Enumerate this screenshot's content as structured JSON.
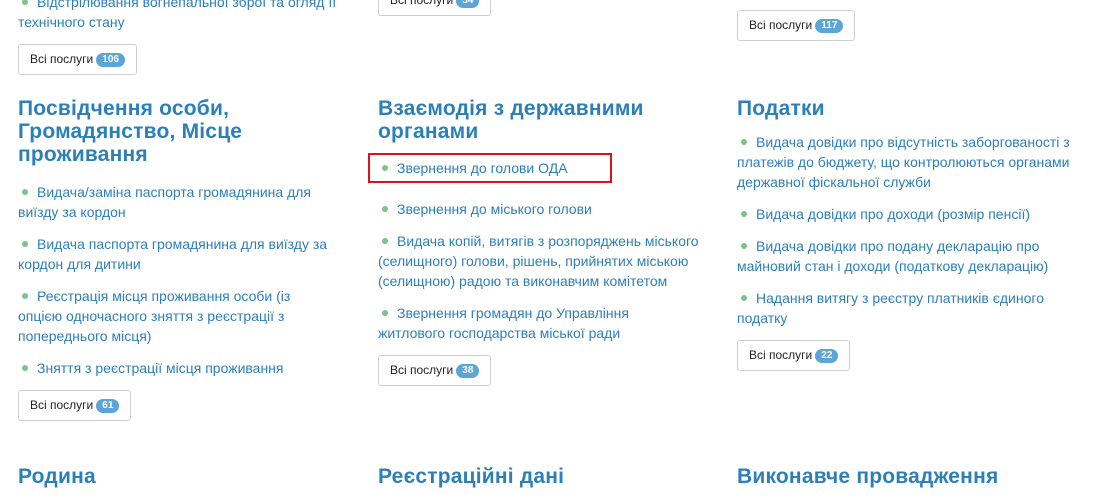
{
  "button_label": "Всі послуги",
  "colors": {
    "heading": "#2d7fb8",
    "link": "#2d7fb8",
    "bullet": "#7cc38a",
    "badge": "#5aa6d8",
    "highlight_border": "#e0101a"
  },
  "col1": {
    "top_item": "Відстрілювання вогнепальної зброї та огляд її технічного стану",
    "top_count": "106",
    "identity": {
      "title": "Посвідчення особи, Громадянство, Місце проживання",
      "items": [
        "Видача/заміна паспорта громадянина для виїзду за кордон",
        "Видача паспорта громадянина для виїзду за кордон для дитини",
        "Реєстрація місця проживання особи (із опцією одночасного зняття з реєстрації з попереднього місця)",
        "Зняття з реєстрації місця проживання"
      ],
      "count": "61"
    },
    "next_title": "Родина"
  },
  "col2": {
    "top_count": "54",
    "gov": {
      "title": "Взаємодія з державними органами",
      "items": [
        "Звернення до голови ОДА",
        "Звернення до міського голови",
        "Видача копій, витягів з розпоряджень міського (селищного) голови, рішень, прийнятих міською (селищною) радою та виконавчим комітетом",
        "Звернення громадян до Управління житлового господарства міської ради"
      ],
      "count": "38"
    },
    "next_title": "Реєстраційні дані"
  },
  "col3": {
    "top_count": "117",
    "taxes": {
      "title": "Податки",
      "items": [
        "Видача довідки про відсутність заборгованості з платежів до бюджету, що контролюються органами державної фіскальної служби",
        "Видача довідки про доходи (розмір пенсії)",
        "Видача довідки про подану декларацію про майновий стан і доходи (податкову декларацію)",
        "Надання витягу з реєстру платників єдиного податку"
      ],
      "count": "22"
    },
    "next_title": "Виконавче провадження"
  }
}
